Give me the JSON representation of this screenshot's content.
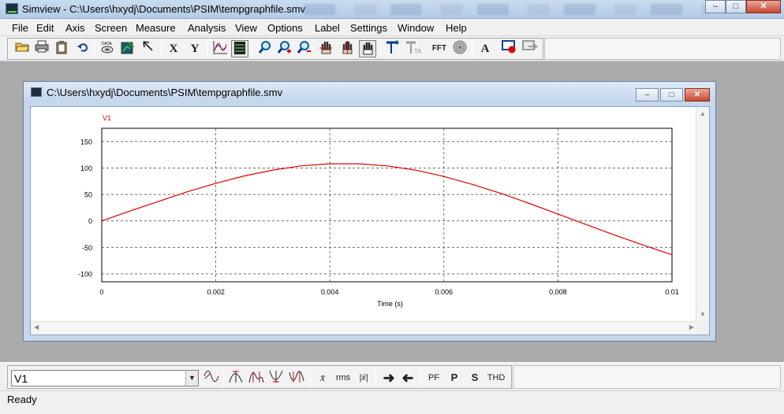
{
  "app": {
    "title": "Simview - C:\\Users\\hxydj\\Documents\\PSIM\\tempgraphfile.smv",
    "minimize_glyph": "–",
    "maximize_glyph": "□",
    "close_glyph": "✕"
  },
  "menu": [
    "File",
    "Edit",
    "Axis",
    "Screen",
    "Measure",
    "Analysis",
    "View",
    "Options",
    "Label",
    "Settings",
    "Window",
    "Help"
  ],
  "toolbar": {
    "open_icon": "open-folder-icon",
    "print_icon": "printer-icon",
    "copy_icon": "clipboard-icon",
    "undo_icon": "undo-icon",
    "data_icon": "data-icon",
    "x_label": "X",
    "y_label": "Y",
    "fft_label": "FFT",
    "text_label": "A",
    "active_tool": "pan-hand"
  },
  "child_window": {
    "title": "C:\\Users\\hxydj\\Documents\\PSIM\\tempgraphfile.smv",
    "minimize_glyph": "–",
    "maximize_glyph": "□",
    "close_glyph": "✕"
  },
  "chart_data": {
    "type": "line",
    "title": "",
    "xlabel": "Time (s)",
    "ylabel": "",
    "xlim": [
      0,
      0.01
    ],
    "ylim": [
      -115,
      175
    ],
    "x_ticks": [
      "0",
      "0.002",
      "0.004",
      "0.006",
      "0.008",
      "0.01"
    ],
    "x_tick_values": [
      0,
      0.002,
      0.004,
      0.006,
      0.008,
      0.01
    ],
    "y_ticks": [
      "150",
      "100",
      "50",
      "0",
      "-50",
      "-100"
    ],
    "y_tick_values": [
      150,
      100,
      50,
      0,
      -50,
      -100
    ],
    "grid": true,
    "legend": "top-left",
    "series": [
      {
        "name": "V1",
        "color": "#e00000",
        "x": [
          0,
          0.0005,
          0.001,
          0.0015,
          0.002,
          0.0025,
          0.003,
          0.0035,
          0.004,
          0.0045,
          0.005,
          0.0055,
          0.006,
          0.0065,
          0.007,
          0.0075,
          0.008,
          0.0085,
          0.009,
          0.0095,
          0.01
        ],
        "y": [
          0,
          19,
          37,
          55,
          71,
          85,
          96,
          104,
          108,
          108,
          104,
          96,
          84,
          69,
          52,
          33,
          13,
          -7,
          -27,
          -46,
          -64
        ]
      }
    ]
  },
  "measure_bar": {
    "selected_curve": "V1",
    "buttons": [
      "x̄",
      "rms",
      "|x̄|",
      "PF",
      "P",
      "S",
      "THD"
    ]
  },
  "status": {
    "text": "Ready"
  }
}
